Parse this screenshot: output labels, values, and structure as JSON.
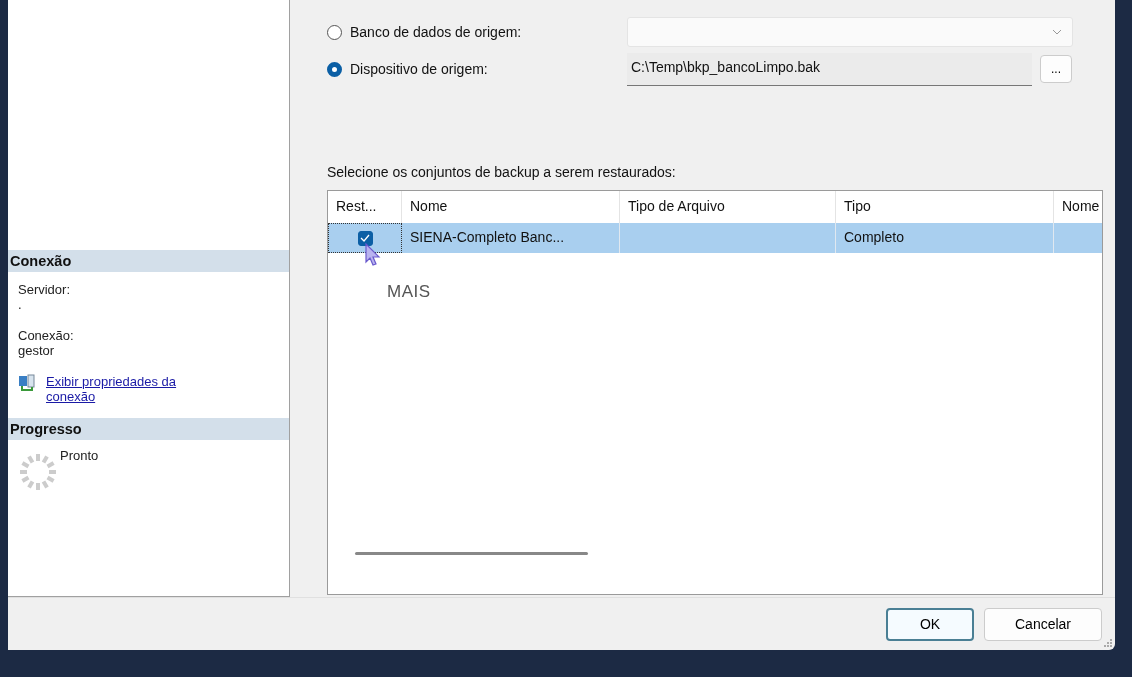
{
  "sidebar": {
    "sections": [
      {
        "kind": "connection",
        "title": "Conexão",
        "fields": [
          {
            "label": "Servidor:",
            "value": "."
          },
          {
            "label": "Conexão:",
            "value": "gestor"
          }
        ],
        "link": "Exibir propriedades da conexão"
      },
      {
        "kind": "progress",
        "title": "Progresso",
        "status": "Pronto"
      }
    ]
  },
  "source": {
    "options": [
      {
        "label": "Banco de dados de origem:",
        "selected": false,
        "kind": "dropdown",
        "disabled": true
      },
      {
        "label": "Dispositivo de origem:",
        "selected": true,
        "kind": "file",
        "value": "C:\\Temp\\bkp_bancoLimpo.bak",
        "button": "..."
      }
    ]
  },
  "backup_sets": {
    "label": "Selecione os conjuntos de backup a serem restaurados:",
    "columns": [
      "Rest...",
      "Nome",
      "Tipo de Arquivo",
      "Tipo",
      "Nome"
    ],
    "rows": [
      {
        "checked": true,
        "selected": true,
        "cells": [
          "",
          "SIENA-Completo Banc...",
          "",
          "Completo",
          ""
        ]
      }
    ]
  },
  "overlay_caption": "MAIS",
  "buttons": [
    {
      "label": "OK",
      "default": true
    },
    {
      "label": "Cancelar",
      "default": false
    }
  ]
}
